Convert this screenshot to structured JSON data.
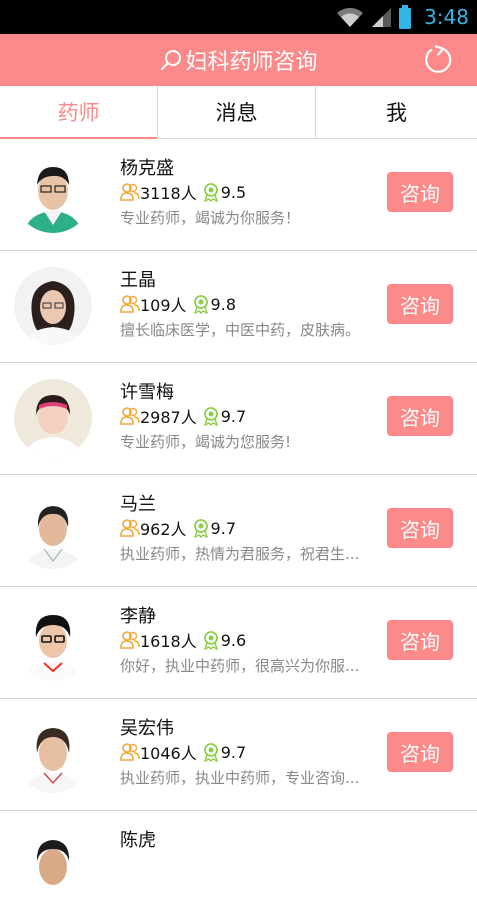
{
  "status_bar": {
    "time": "3:48"
  },
  "app_bar": {
    "title": "妇科药师咨询"
  },
  "tabs": [
    {
      "label": "药师",
      "active": true
    },
    {
      "label": "消息",
      "active": false
    },
    {
      "label": "我",
      "active": false
    }
  ],
  "colors": {
    "accent": "#fc8a8a",
    "status_time": "#33b5e5",
    "followers_icon": "#f0a830",
    "rating_icon": "#8ccf4a"
  },
  "pharmacists": [
    {
      "name": "杨克盛",
      "followers": "3118人",
      "rating": "9.5",
      "desc": "专业药师，竭诚为你服务！",
      "button": "咨询"
    },
    {
      "name": "王晶",
      "followers": "109人",
      "rating": "9.8",
      "desc": "擅长临床医学，中医中药，皮肤病。",
      "button": "咨询"
    },
    {
      "name": "许雪梅",
      "followers": "2987人",
      "rating": "9.7",
      "desc": "专业药师，竭诚为您服务!",
      "button": "咨询"
    },
    {
      "name": "马兰",
      "followers": "962人",
      "rating": "9.7",
      "desc": "执业药师，热情为君服务，祝君生...",
      "button": "咨询"
    },
    {
      "name": "李静",
      "followers": "1618人",
      "rating": "9.6",
      "desc": "你好，执业中药师，很高兴为你服...",
      "button": "咨询"
    },
    {
      "name": "吴宏伟",
      "followers": "1046人",
      "rating": "9.7",
      "desc": "执业药师，执业中药师，专业咨询...",
      "button": "咨询"
    },
    {
      "name": "陈虎"
    }
  ]
}
